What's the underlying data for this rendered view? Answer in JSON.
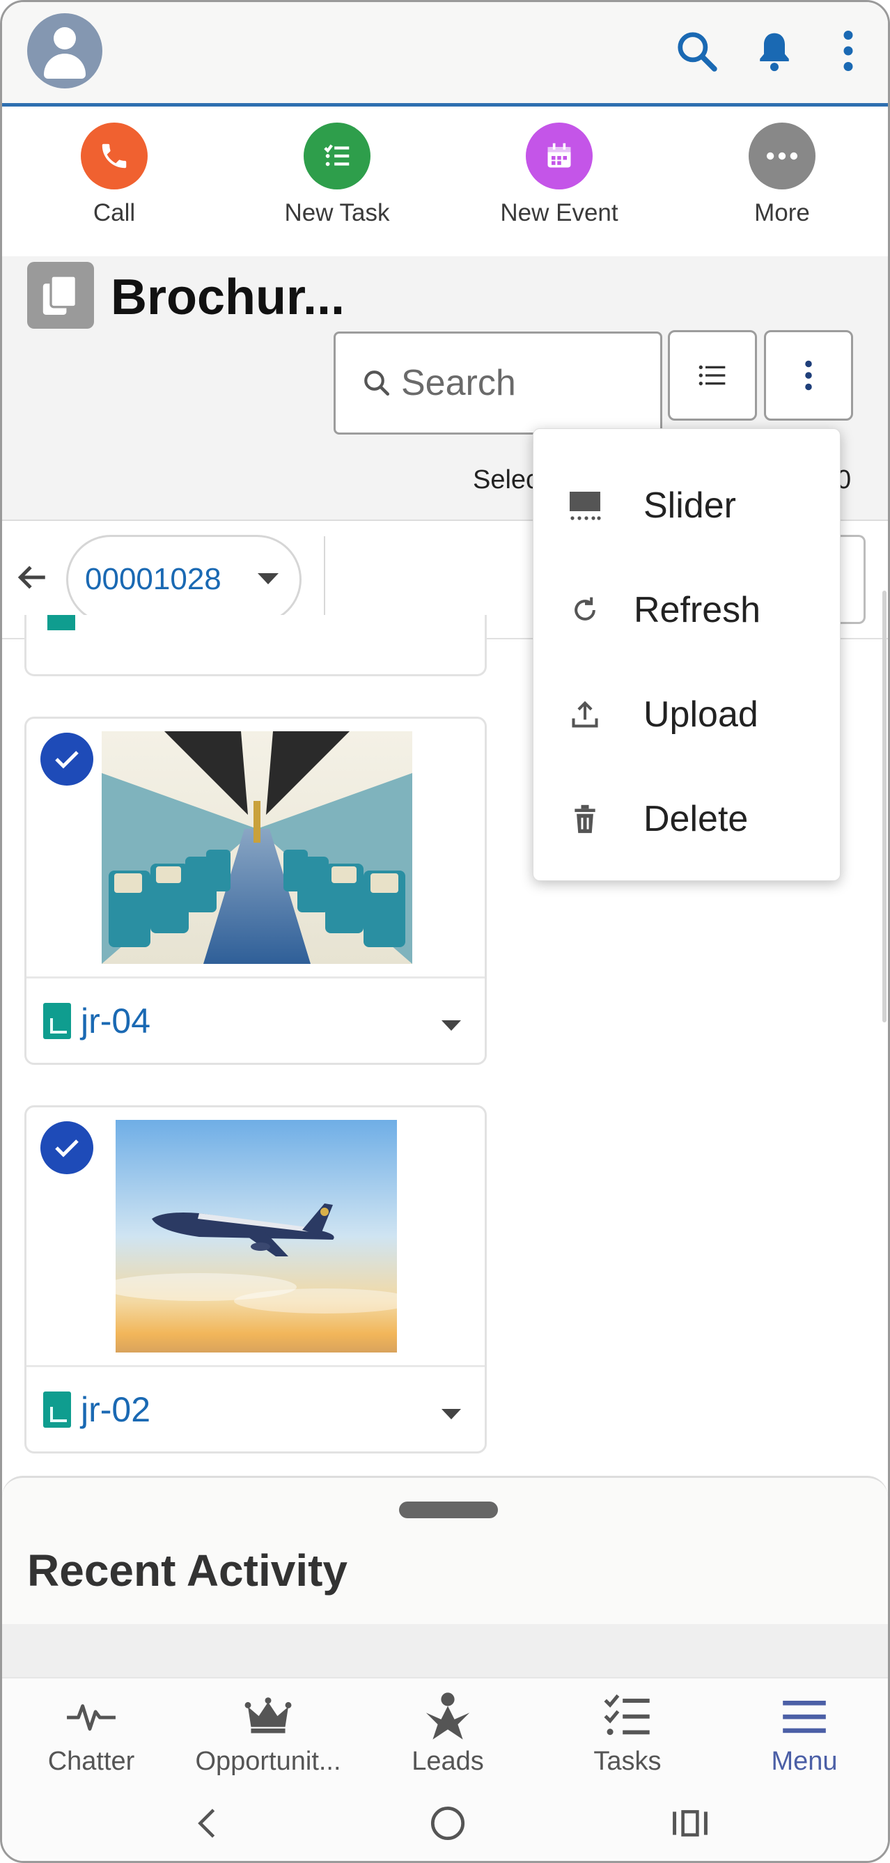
{
  "quick_actions": [
    {
      "label": "Call",
      "color": "#f06130",
      "icon": "phone-icon"
    },
    {
      "label": "New Task",
      "color": "#2e9e4b",
      "icon": "task-icon"
    },
    {
      "label": "New Event",
      "color": "#c455e8",
      "icon": "calendar-icon"
    },
    {
      "label": "More",
      "color": "#888888",
      "icon": "more-dots-icon"
    }
  ],
  "header": {
    "title": "Brochur...",
    "search_placeholder": "Search",
    "selected_text": "Selec",
    "selected_count": "0"
  },
  "filter": {
    "record_value": "00001028"
  },
  "cards": [
    {
      "name": "jr-04",
      "selected": true,
      "image": "airplane-cabin"
    },
    {
      "name": "jr-02",
      "selected": true,
      "image": "airplane-in-sky"
    }
  ],
  "menu": {
    "items": [
      {
        "label": "Slider",
        "icon": "slider-icon"
      },
      {
        "label": "Refresh",
        "icon": "refresh-icon"
      },
      {
        "label": "Upload",
        "icon": "upload-icon"
      },
      {
        "label": "Delete",
        "icon": "trash-icon"
      }
    ]
  },
  "recent_activity": {
    "title": "Recent Activity"
  },
  "tabs": [
    {
      "label": "Chatter",
      "icon": "pulse-icon"
    },
    {
      "label": "Opportunit...",
      "icon": "crown-icon"
    },
    {
      "label": "Leads",
      "icon": "person-star-icon"
    },
    {
      "label": "Tasks",
      "icon": "checklist-icon"
    },
    {
      "label": "Menu",
      "icon": "hamburger-icon",
      "active_color": "#4b5fa6"
    }
  ],
  "colors": {
    "accent": "#1a69b3",
    "topbar_border": "#2e6fb0",
    "check": "#1e4bb8"
  }
}
